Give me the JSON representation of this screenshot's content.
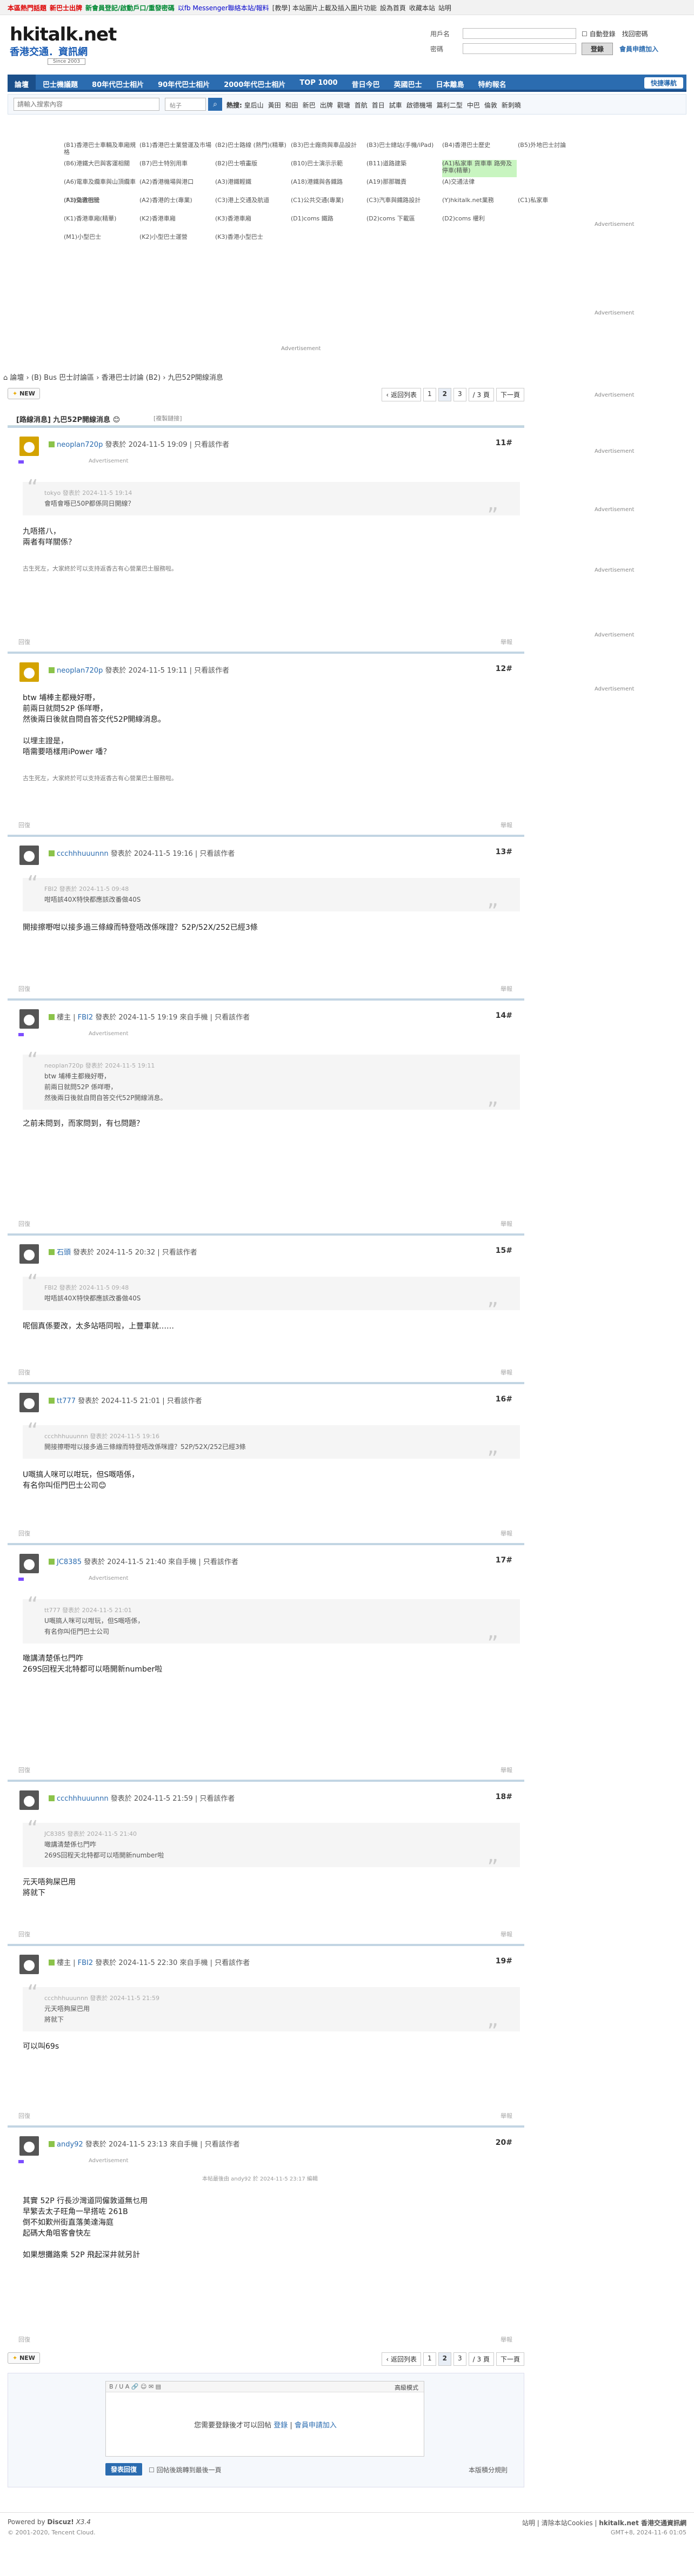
{
  "topbar": {
    "items": [
      {
        "t": "本區熱門話題",
        "c": "#d00"
      },
      {
        "t": "新巴士出牌",
        "c": "#d00"
      },
      {
        "t": "新會員登記/啟動戶口/重發密碼",
        "c": "#083"
      },
      {
        "t": "以fb Messenger聯絡本站/報料",
        "c": "#00c"
      },
      {
        "t": "[教學] 本站圖片上載及插入圖片功能",
        "c": "#333"
      },
      {
        "t": "設為首頁",
        "c": "#333"
      },
      {
        "t": "收藏本站",
        "c": "#333"
      },
      {
        "t": "站明",
        "c": "#333"
      }
    ]
  },
  "logo": {
    "line1": "hkitalk.net",
    "line2": "香港交通．資訊網",
    "line3": "Since 2003"
  },
  "login": {
    "user_label": "用戶名",
    "pass_label": "密碼",
    "auto": "自動登錄",
    "forgot": "找回密碼",
    "submit": "登錄",
    "register": "會員申請加入"
  },
  "nav": {
    "items": [
      "論壇",
      "巴士機議題",
      "80年代巴士相片",
      "90年代巴士相片",
      "2000年代巴士相片",
      "TOP 1000",
      "昔日今巴",
      "英國巴士",
      "日本離島",
      "特約報名"
    ],
    "quick": "快捷導航"
  },
  "search": {
    "placeholder": "請輸入搜索內容",
    "select": "帖子",
    "hot_label": "熱搜:",
    "hot": [
      "皇后山",
      "黃田",
      "和田",
      "新巴",
      "出牌",
      "觀塘",
      "首航",
      "首日",
      "試車",
      "啟德機場",
      "篇利二型",
      "中巴",
      "倫敦",
      "新刺曉"
    ]
  },
  "forums": [
    [
      "(B1)香港巴士車輛及車廂規格",
      "(B1)香港巴士業營運及市場",
      "(B2)巴士路線 (熱門)(精華)",
      "(B3)巴士廠商與車品設計",
      "(B3)巴士總站(手機/iPad)",
      "(B4)香港巴士歷史",
      "(B5)外地巴士討論"
    ],
    [
      "(B6)港鐵大巴與客運相關",
      "(B7)巴士特別用車",
      "(B2)巴士噴畫版",
      "(B10)巴士演示示範",
      "(B11)道路建築",
      "(A1)私家車 貨車車 路旁及停車(精華)",
      ""
    ],
    [
      "(A6)電車及纜車與山頂纜車",
      "(A2)香港機場與港口",
      "(A3)港鐵輕鐵",
      "(A18)港鐵與各鐵路",
      "(A19)那那職責",
      "(A)交通法律",
      "",
      ""
    ],
    [
      "(F1)交通相關",
      "(A2)香港的士(專業)",
      "(C3)港上交通及航道",
      "(C1)公共交通(專業)",
      "(C3)汽車與鐵路設計",
      "(Y)hkitalk.net業務",
      "(C1)私家車",
      "(A3)倫敦巴士"
    ],
    [
      "(K1)香港車廂(精華)",
      "(K2)香港車廂",
      "(K3)香港車廂",
      "(D1)coms 鐵路",
      "(D2)coms 下載區",
      "(D2)coms 權利"
    ],
    [
      "(M1)小型巴士",
      "(K2)小型巴士運營",
      "(K3)香港小型巴士"
    ]
  ],
  "ad_label": "Advertisement",
  "breadcrumb": [
    "論壇",
    "(B) Bus 巴士討論區",
    "香港巴士討論 (B2)",
    "九巴52P開線消息"
  ],
  "controls": {
    "new": "NEW",
    "back": "返回列表",
    "pages": [
      "1",
      "2",
      "3"
    ],
    "cur": "2",
    "total": "/ 3 頁",
    "next": "下一頁"
  },
  "thread": {
    "title": "[路線消息] 九巴52P開線消息",
    "badge": "😊",
    "copy": "[複製鏈接]"
  },
  "posts": [
    {
      "user": "neoplan720p",
      "date": "發表於 2024-11-5 19:09",
      "only": "只看該作者",
      "num": "11",
      "ad": "Advertisement",
      "quote_head": "tokyo 發表於 2024-11-5 19:14",
      "quote_body": "會唔會喺已50P都係同日開線？",
      "body": "九唔搭八，\n兩者有咩關係？",
      "sig": "古生死左，大家終於可以支持返香古有心營業巴士服務啦。",
      "footl": "回復",
      "footr": "舉報"
    },
    {
      "user": "neoplan720p",
      "date": "發表於 2024-11-5 19:11",
      "only": "只看該作者",
      "num": "12",
      "body": "btw 埔棒主都幾好嘢，\n前兩日就問52P 係咩嘢，\n然後兩日後就自問自答交代52P開線消息。\n\n以埋主證是，\n唔需要唔樣用iPower 噃？",
      "sig": "古生死左，大家終於可以支持返香古有心營業巴士服務啦。",
      "footl": "回復",
      "footr": "舉報"
    },
    {
      "user": "ccchhhuuunnn",
      "date": "發表於 2024-11-5 19:16",
      "only": "只看該作者",
      "num": "13",
      "quote_head": "FBI2 發表於 2024-11-5 09:48",
      "quote_body": "咁唔該40X特快都應該改番做40S",
      "body": "開接擦嘢咁以接多過三條線而特登唔改係咪證？52P/52X/252已經3條",
      "footl": "回復",
      "footr": "舉報"
    },
    {
      "user": "FBI2",
      "pre": "樓主",
      "date": "發表於 2024-11-5 19:19",
      "via": "來自手機",
      "only": "只看該作者",
      "num": "14",
      "ad": "Advertisement",
      "quote_head": "neoplan720p 發表於 2024-11-5 19:11",
      "quote_body": "btw 埔棒主都幾好嘢，\n前兩日就問52P 係咩嘢，\n然後兩日後就自問自答交代52P開線消息。",
      "body": "之前未問到，而家問到，有乜問題？",
      "footl": "回復",
      "footr": "舉報"
    },
    {
      "user": "石頭",
      "date": "發表於 2024-11-5 20:32",
      "only": "只看該作者",
      "num": "15",
      "quote_head": "FBI2 發表於 2024-11-5 09:48",
      "quote_body": "咁唔該40X特快都應該改番做40S",
      "body": "呢個真係要改，太多站唔同啦，上豐車就……",
      "footl": "回復",
      "footr": "舉報"
    },
    {
      "user": "tt777",
      "date": "發表於 2024-11-5 21:01",
      "only": "只看該作者",
      "num": "16",
      "quote_head": "ccchhhuuunnn 發表於 2024-11-5 19:16",
      "quote_body": "開接擦嘢咁以接多過三條線而特登唔改係咪證？52P/52X/252已經3條",
      "body": "U嘅搞人咪可以咁玩，但S嘅唔係，\n有名你叫佢門巴士公司😊",
      "footl": "回復",
      "footr": "舉報"
    },
    {
      "user": "JC8385",
      "date": "發表於 2024-11-5 21:40",
      "via": "來自手機",
      "only": "只看該作者",
      "num": "17",
      "ad": "Advertisement",
      "quote_head": "tt777 發表於 2024-11-5 21:01",
      "quote_body": "U嘅搞人咪可以咁玩，但S嘅唔係，\n有名你叫佢門巴士公司",
      "body": "噉講清楚係乜門咋\n269S回程天北特都可以唔開新number啦",
      "footl": "回復",
      "footr": "舉報"
    },
    {
      "user": "ccchhhuuunnn",
      "date": "發表於 2024-11-5 21:59",
      "only": "只看該作者",
      "num": "18",
      "quote_head": "JC8385 發表於 2024-11-5 21:40",
      "quote_body": "噉講清楚係乜門咋\n269S回程天北特都可以唔開新number啦",
      "body": "元天唔夠屎巴用\n將就下",
      "footl": "回復",
      "footr": "舉報"
    },
    {
      "user": "FBI2",
      "pre": "樓主",
      "date": "發表於 2024-11-5 22:30",
      "via": "來自手機",
      "only": "只看該作者",
      "num": "19",
      "quote_head": "ccchhhuuunnn 發表於 2024-11-5 21:59",
      "quote_body": "元天唔夠屎巴用\n將就下",
      "body": "可以叫69s",
      "footl": "回復",
      "footr": "舉報"
    },
    {
      "user": "andy92",
      "date": "發表於 2024-11-5 23:13",
      "via": "來自手機",
      "only": "只看該作者",
      "num": "20",
      "ad": "Advertisement",
      "edited": "本帖最後由 andy92 於 2024-11-5 23:17 編輯",
      "body": "其實 52P 行長沙灣道同僱敦道無乜用\n早繁去太子旺角一早搭咗 261B\n倒不如歎州街直落美達海庭\n起碼大角咀客會快左\n\n如果想攤路乘 52P 飛起深井就另計",
      "footl": "回復",
      "footr": "舉報"
    }
  ],
  "reply": {
    "mode": "高級模式",
    "msg_pre": "您需要登錄後才可以回帖",
    "login": "登錄",
    "sep": "|",
    "register": "會員申請加入",
    "submit": "發表回復",
    "check": "回帖後跳轉到最後一頁",
    "rule": "本版積分規則"
  },
  "footer": {
    "powered": "Powered by",
    "discuz": "Discuz!",
    "ver": "X3.4",
    "copy": "© 2001-2020, Tencent Cloud.",
    "links": "站明 | 清除本站Cookies |",
    "site": "hkitalk.net 香港交通資訊網",
    "time": "GMT+8, 2024-11-6 01:05"
  }
}
